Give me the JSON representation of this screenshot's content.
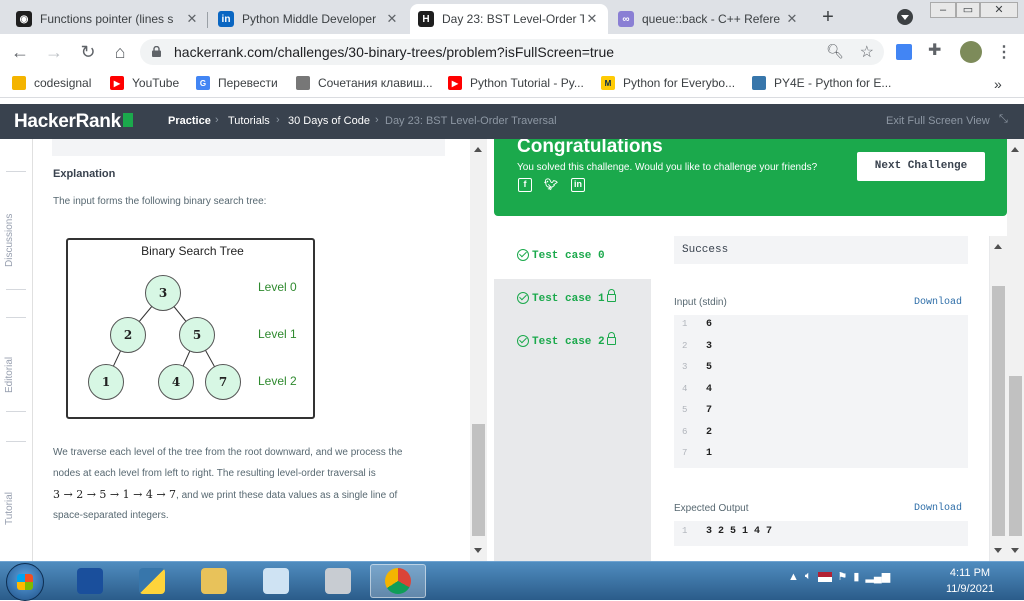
{
  "browser": {
    "tabs": [
      {
        "title": "Functions pointer (lines s",
        "favicon": "#1f1f1f",
        "active": false
      },
      {
        "title": "Python Middle Developer",
        "favicon": "#0a66c2",
        "active": false
      },
      {
        "title": "Day 23: BST Level-Order T",
        "favicon": "#1f1f1f",
        "active": true
      },
      {
        "title": "queue::back - C++ Refere",
        "favicon": "#8a7fd4",
        "active": false
      }
    ],
    "new_tab": "+",
    "url": "hackerrank.com/challenges/30-binary-trees/problem?isFullScreen=true",
    "bookmarks": [
      {
        "label": "codesignal",
        "color": "#f4b400"
      },
      {
        "label": "YouTube",
        "color": "#ff0000"
      },
      {
        "label": "Перевести",
        "color": "#4285f4"
      },
      {
        "label": "Сочетания клавиш...",
        "color": "#777777"
      },
      {
        "label": "Python Tutorial - Py...",
        "color": "#ff0000"
      },
      {
        "label": "Python for Everybo...",
        "color": "#00274c"
      },
      {
        "label": "PY4E - Python for E...",
        "color": "#3776ab"
      }
    ],
    "more_bookmarks": "»"
  },
  "header": {
    "logo": "HackerRank",
    "breadcrumbs": [
      "Practice",
      "Tutorials",
      "30 Days of Code",
      "Day 23: BST Level-Order Traversal"
    ],
    "exit_label": "Exit Full Screen View"
  },
  "sidebar_tabs": [
    "Discussions",
    "Editorial",
    "Tutorial"
  ],
  "problem": {
    "explanation_title": "Explanation",
    "explanation_text": "The input forms the following binary search tree:",
    "tree": {
      "title": "Binary Search Tree",
      "levels": [
        "Level 0",
        "Level 1",
        "Level 2"
      ],
      "nodes": [
        "3",
        "2",
        "5",
        "1",
        "4",
        "7"
      ]
    },
    "para_lines": [
      "We traverse each level of the tree from the root downward, and we process the",
      "nodes at each level from left to right. The resulting level-order traversal is"
    ],
    "sequence": "3 → 2 → 5 → 1 → 4 → 7",
    "sequence_suffix": ", and we print these data values as a single line of",
    "para_last": "space-separated integers."
  },
  "congrats": {
    "title": "Congratulations",
    "subtitle": "You solved this challenge. Would you like to challenge your friends?",
    "next_button": "Next Challenge"
  },
  "testcases": {
    "items": [
      "Test case 0",
      "Test case 1",
      "Test case 2"
    ],
    "status": "Success",
    "input_label": "Input (stdin)",
    "download_label": "Download",
    "input_lines": [
      {
        "n": "1",
        "v": "6"
      },
      {
        "n": "2",
        "v": "3"
      },
      {
        "n": "3",
        "v": "5"
      },
      {
        "n": "4",
        "v": "4"
      },
      {
        "n": "5",
        "v": "7"
      },
      {
        "n": "6",
        "v": "2"
      },
      {
        "n": "7",
        "v": "1"
      }
    ],
    "expected_label": "Expected Output",
    "expected_lines": [
      {
        "n": "1",
        "v": "3 2 5 1 4 7"
      }
    ]
  },
  "taskbar": {
    "time": "4:11 PM",
    "date": "11/9/2021"
  }
}
